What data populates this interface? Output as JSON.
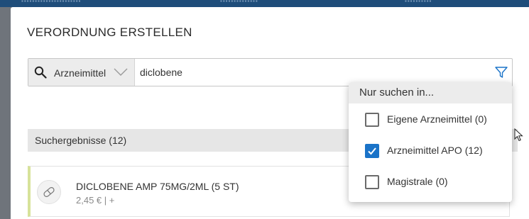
{
  "modal": {
    "title": "VERORDNUNG ERSTELLEN"
  },
  "search": {
    "type_label": "Arzneimittel",
    "query": "diclobene",
    "icons": {
      "search": "search-icon",
      "chevron": "chevron-down-icon",
      "filter": "filter-icon"
    }
  },
  "filter_dropdown": {
    "header": "Nur suchen in...",
    "options": [
      {
        "label": "Eigene Arzneimittel (0)",
        "checked": false
      },
      {
        "label": "Arzneimittel APO (12)",
        "checked": true
      },
      {
        "label": "Magistrale (0)",
        "checked": false
      }
    ]
  },
  "results": {
    "header": "Suchergebnisse (12)",
    "items": [
      {
        "name": "DICLOBENE AMP 75MG/2ML (5 ST)",
        "price": "2,45 € | +",
        "icon": "pill-icon"
      }
    ]
  },
  "colors": {
    "accent": "#1a73c8",
    "result_marker": "#d7e29a",
    "topbar": "#1f4d7a"
  }
}
